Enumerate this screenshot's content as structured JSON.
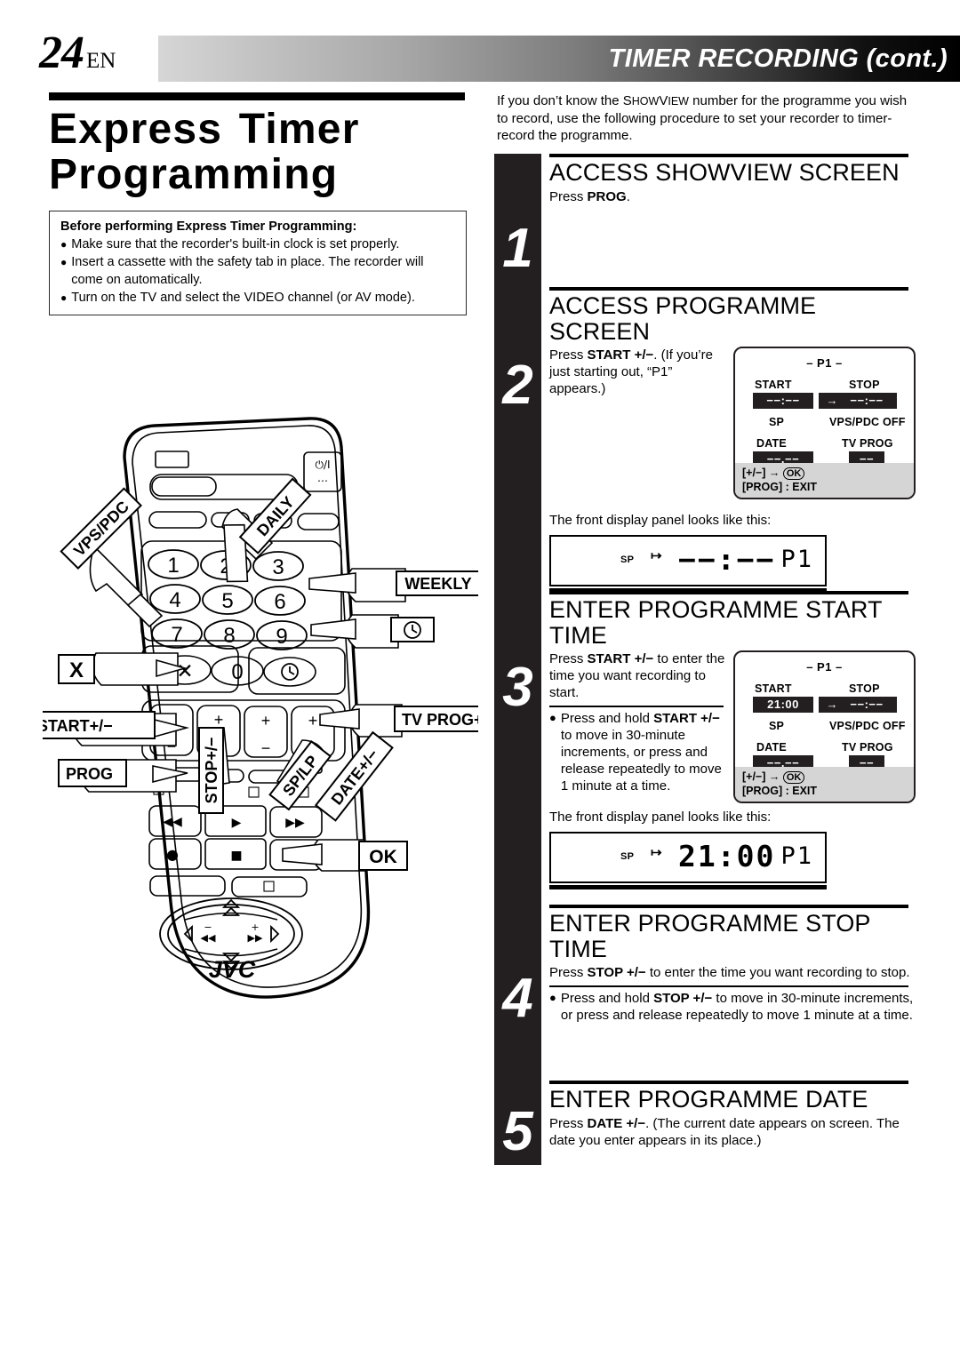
{
  "header": {
    "page_number": "24",
    "page_lang": "EN",
    "title": "TIMER RECORDING (cont.)"
  },
  "left": {
    "main_title_line1": "Express Timer",
    "main_title_line2": "Programming",
    "notice": {
      "title": "Before performing Express Timer Programming:",
      "bullet_glyph": "●",
      "items": [
        "Make sure that the recorder's built-in clock is set properly.",
        "Insert a cassette with the safety tab in place. The recorder will come on automatically.",
        "Turn on the TV and select the VIDEO channel (or AV mode)."
      ]
    },
    "remote": {
      "brand": "JVC",
      "callouts": [
        "VPS/PDC",
        "DAILY",
        "WEEKLY",
        "clock-icon",
        "X",
        "TV PROG+/−",
        "START+/−",
        "DATE+/−",
        "PROG",
        "STOP+/−",
        "SP/LP",
        "OK"
      ],
      "keypad": [
        "1",
        "2",
        "3",
        "4",
        "5",
        "6",
        "7",
        "8",
        "9",
        "0"
      ],
      "power_label": "⏻/I"
    }
  },
  "right": {
    "intro": {
      "part1": "If you don’t know the ",
      "brand_show": "S",
      "brand_how": "HOW",
      "brand_v": "V",
      "brand_iew": "IEW",
      "part2": " number for the programme you wish to record, use the following procedure to set your recorder to timer-record the programme."
    },
    "steps": [
      {
        "number": "1",
        "heading": "ACCESS SHOWVIEW SCREEN",
        "body_prefix": "Press ",
        "body_bold": "PROG",
        "body_suffix": "."
      },
      {
        "number": "2",
        "heading": "ACCESS PROGRAMME SCREEN",
        "body_prefix": "Press ",
        "body_bold": "START +/−",
        "body_suffix": ". (If you’re just starting out, “P1” appears.)",
        "caption": "The front display panel looks like this:"
      },
      {
        "number": "3",
        "heading": "ENTER PROGRAMME START TIME",
        "body_prefix": "Press ",
        "body_bold": "START +/−",
        "body_suffix": " to enter the time you want recording to start.",
        "bullet_prefix": "Press and hold ",
        "bullet_bold": "START +/−",
        "bullet_suffix": " to move in 30-minute increments, or press and release repeatedly to move 1 minute at a time.",
        "caption": "The front display panel looks like this:"
      },
      {
        "number": "4",
        "heading": "ENTER PROGRAMME STOP TIME",
        "body_prefix": "Press ",
        "body_bold": "STOP +/−",
        "body_suffix": " to enter the time you want recording to stop.",
        "bullet_prefix": "Press and hold ",
        "bullet_bold": "STOP +/−",
        "bullet_suffix": " to move in 30-minute increments, or press and release repeatedly to move 1 minute at a time."
      },
      {
        "number": "5",
        "heading": "ENTER PROGRAMME DATE",
        "body_prefix": "Press ",
        "body_bold": "DATE +/−",
        "body_suffix": ". (The current date appears on screen. The date you enter appears in its place.)"
      }
    ],
    "osd_step2": {
      "program_label": "– P1 –",
      "start_label": "START",
      "start_value": "−−:−−",
      "arrow": "→",
      "stop_label": "STOP",
      "stop_value": "−−:−−",
      "speed_label": "SP",
      "vps_label": "VPS/PDC OFF",
      "date_label": "DATE",
      "date_value": "−−.−−",
      "tvprog_label": "TV PROG",
      "tvprog_value": "−−",
      "foot_line1_pre": "[+/−] ",
      "foot_line1_arrow": "→",
      "foot_line1_ok": "OK",
      "foot_line2": "[PROG] : EXIT"
    },
    "osd_step3": {
      "program_label": "– P1 –",
      "start_label": "START",
      "start_value": "21:00",
      "arrow": "→",
      "stop_label": "STOP",
      "stop_value": "−−:−−",
      "speed_label": "SP",
      "vps_label": "VPS/PDC OFF",
      "date_label": "DATE",
      "date_value": "−−.−−",
      "tvprog_label": "TV PROG",
      "tvprog_value": "−−",
      "foot_line1_pre": "[+/−] ",
      "foot_line1_arrow": "→",
      "foot_line1_ok": "OK",
      "foot_line2": "[PROG] : EXIT"
    },
    "front_panel_step2": {
      "speed": "SP",
      "timer_icon": "↦",
      "digits": "−−:−−",
      "program": "P1"
    },
    "front_panel_step3": {
      "speed": "SP",
      "timer_icon": "↦",
      "digits": "21:00",
      "program": "P1"
    }
  }
}
